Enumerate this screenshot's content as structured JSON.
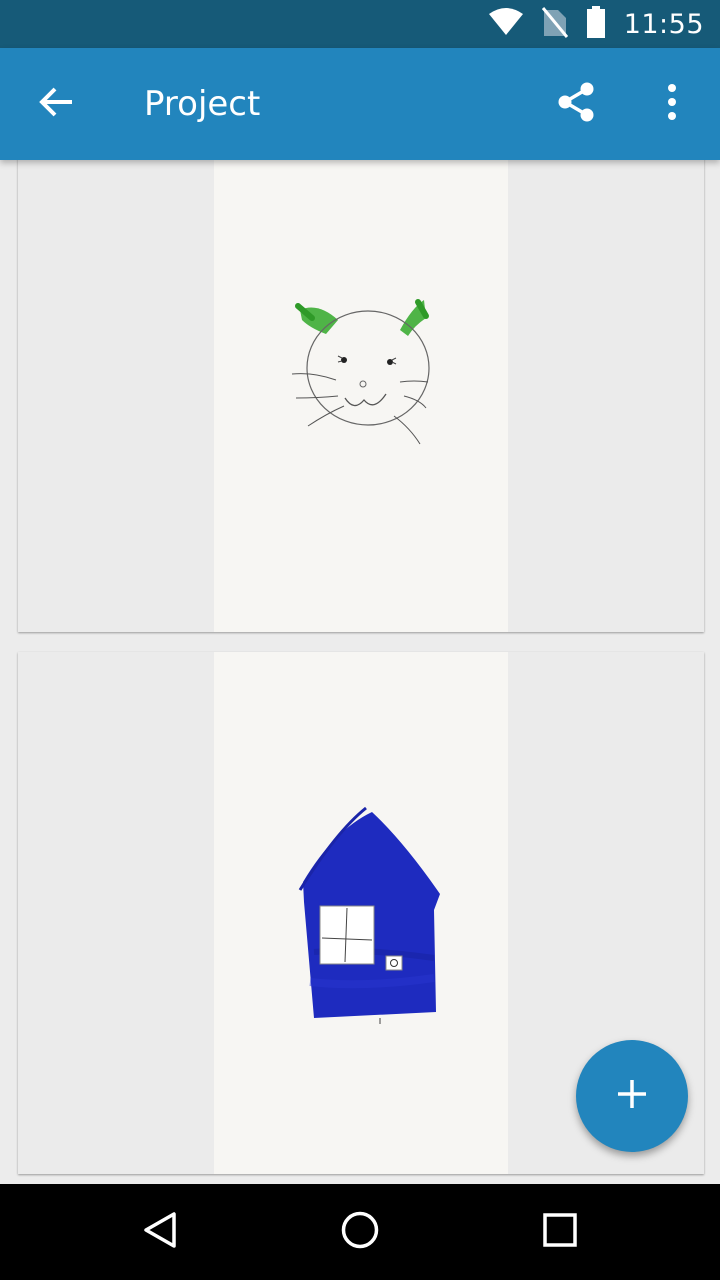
{
  "status_bar": {
    "time": "11:55",
    "icons": [
      "wifi-icon",
      "no-sim-icon",
      "battery-icon"
    ]
  },
  "app_bar": {
    "title": "Project",
    "icons": [
      "back-arrow-icon",
      "share-icon",
      "more-vert-icon"
    ]
  },
  "pages": [
    {
      "drawing": "cat-face",
      "colors": {
        "ears": "#3cad34",
        "lines": "#555555"
      }
    },
    {
      "drawing": "blue-house",
      "colors": {
        "fill": "#1e2bbf",
        "window": "#ffffff"
      }
    }
  ],
  "fab": {
    "icon": "plus-icon"
  },
  "nav_bar": {
    "icons": [
      "back-triangle-icon",
      "home-circle-icon",
      "recents-square-icon"
    ]
  },
  "colors": {
    "status_bar": "#165a78",
    "app_bar": "#2285bd",
    "background": "#ececec",
    "paper": "#f7f6f3"
  }
}
